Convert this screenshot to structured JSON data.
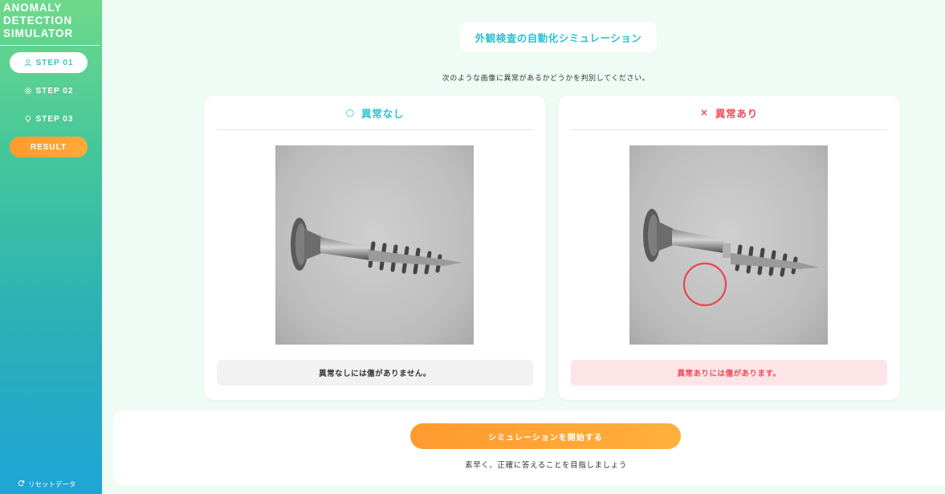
{
  "sidebar": {
    "logo_lines": [
      "ANOMALY",
      "DETECTION",
      "SIMULATOR"
    ],
    "steps": [
      {
        "label": "STEP 01",
        "icon": "user-icon",
        "active": true
      },
      {
        "label": "STEP 02",
        "icon": "gear-icon",
        "active": false
      },
      {
        "label": "STEP 03",
        "icon": "lightbulb-icon",
        "active": false
      }
    ],
    "result_label": "RESULT",
    "reset_label": "リセットデータ",
    "reset_icon": "refresh-icon"
  },
  "main": {
    "title": "外観検査の自動化シミュレーション",
    "instruction": "次のような画像に異常があるかどうかを判別してください。",
    "cards": [
      {
        "mark": "○",
        "heading": "異常なし",
        "image_icon": "screw-icon",
        "note": "異常なしには傷がありません。"
      },
      {
        "mark": "×",
        "heading": "異常あり",
        "image_icon": "screw-defect-icon",
        "note": "異常ありには傷があります。"
      }
    ],
    "start_button": "シミュレーションを開始する",
    "sub_message": "素早く、正確に答えることを目指しましょう"
  },
  "colors": {
    "accent_teal": "#2cc2d2",
    "accent_red": "#ef4b55",
    "accent_orange": "#ff9a2e"
  }
}
